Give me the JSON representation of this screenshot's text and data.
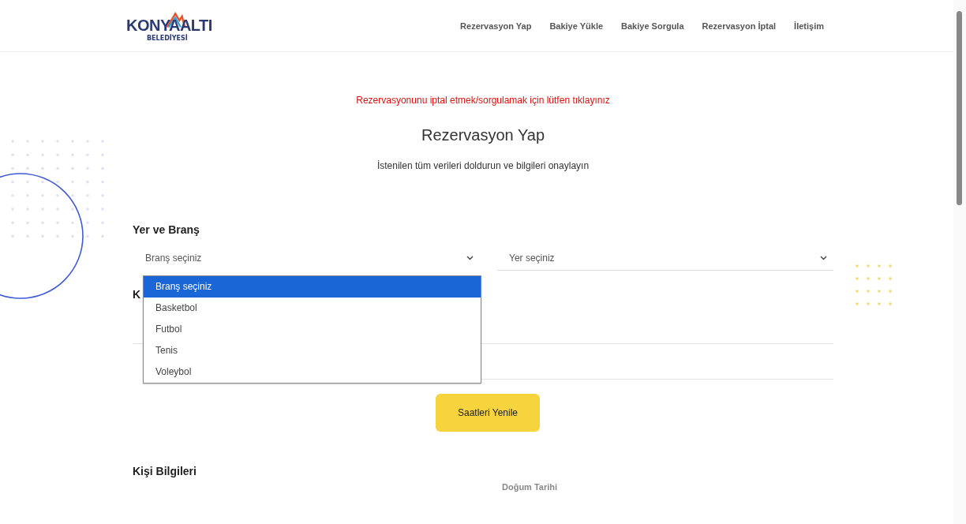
{
  "header": {
    "logo": {
      "name": "KONYAALTI",
      "subtitle": "BELEDİYESİ"
    },
    "nav": [
      {
        "label": "Rezervasyon Yap"
      },
      {
        "label": "Bakiye Yükle"
      },
      {
        "label": "Bakiye Sorgula"
      },
      {
        "label": "Rezervasyon İptal"
      },
      {
        "label": "İletişim"
      }
    ]
  },
  "cancel_link": "Rezervasyonunu iptal etmek/sorgulamak için lütfen tıklayınız",
  "title": "Rezervasyon Yap",
  "subtitle": "İstenilen tüm verileri doldurun ve bilgileri onaylayın",
  "section_place": {
    "heading": "Yer ve Branş",
    "branch_select": {
      "value": "Branş seçiniz",
      "expanded": true,
      "options": [
        {
          "label": "Branş seçiniz",
          "selected": true
        },
        {
          "label": "Basketbol",
          "selected": false
        },
        {
          "label": "Futbol",
          "selected": false
        },
        {
          "label": "Tenis",
          "selected": false
        },
        {
          "label": "Voleybol",
          "selected": false
        }
      ]
    },
    "place_select": {
      "value": "Yer seçiniz"
    }
  },
  "section_hidden_heading": "K",
  "refresh_button": "Saatleri Yenile",
  "section_person": {
    "heading": "Kişi Bilgileri",
    "birth_date_label": "Doğum Tarihi"
  }
}
